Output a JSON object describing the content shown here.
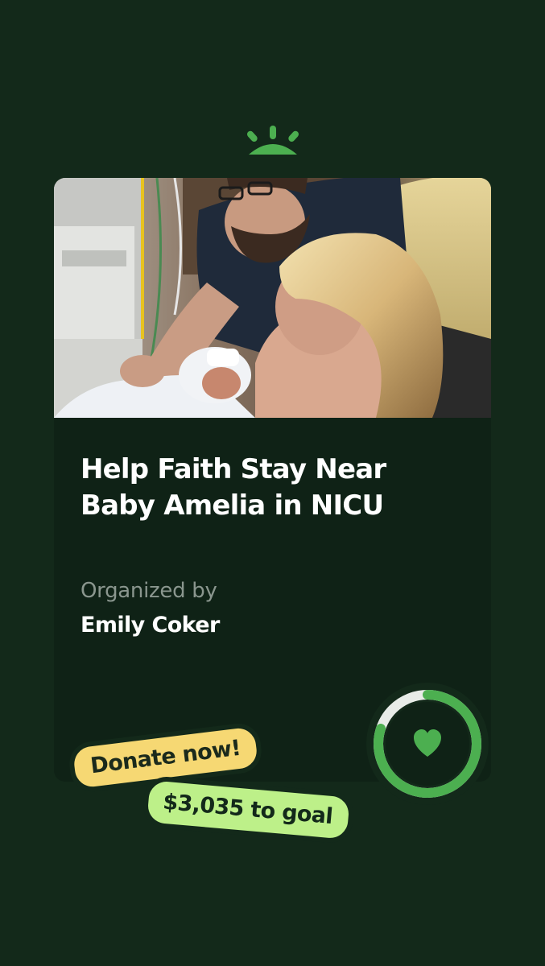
{
  "campaign": {
    "title": "Help Faith Stay Near Baby Amelia in NICU",
    "organized_label": "Organized by",
    "organizer_name": "Emily Coker",
    "donate_label": "Donate now!",
    "goal_text": "$3,035 to goal",
    "progress_fraction": 0.8
  },
  "icons": {
    "logo": "sprout-logo-icon",
    "heart": "heart-icon"
  },
  "colors": {
    "background": "#13291a",
    "card": "#0f2216",
    "accent_green": "#4caf50",
    "donate_yellow": "#f6d873",
    "goal_green": "#bdf089"
  }
}
